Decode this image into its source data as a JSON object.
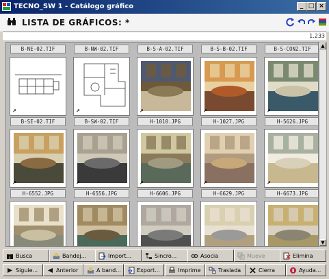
{
  "window": {
    "title": "TECNO_SW 1 - Catálogo gráfico",
    "minimize": "_",
    "maximize": "□",
    "close": "×"
  },
  "header": {
    "title": "LISTA DE GRÁFICOS: *"
  },
  "filter": {
    "count": "1.233"
  },
  "top_row": [
    "B-NE-02.TIF",
    "B-NW-02.TIF",
    "B-S-A-02.TIF",
    "B-S-B-02.TIF",
    "B-S-CON2.TIF"
  ],
  "items": [
    {
      "name": "B-SE-02.TIF",
      "kind": "plan1"
    },
    {
      "name": "B-SW-02.TIF",
      "kind": "plan2"
    },
    {
      "name": "H-1010.JPG",
      "kind": "photo",
      "palette": [
        "#8a7a55",
        "#4f5a70",
        "#c8b89a",
        "#6e5a3a"
      ]
    },
    {
      "name": "H-1027.JPG",
      "kind": "photo",
      "palette": [
        "#b05a2a",
        "#d89a50",
        "#7a4a30",
        "#e8d0a0"
      ]
    },
    {
      "name": "H-5626.JPG",
      "kind": "photo",
      "palette": [
        "#c9c2a8",
        "#7a8a70",
        "#3a5a6a",
        "#e0dcc8"
      ]
    },
    {
      "name": "H-6552.JPG",
      "kind": "photo",
      "palette": [
        "#8a6a40",
        "#c8a060",
        "#4a4a3a",
        "#d8cfb0"
      ]
    },
    {
      "name": "H-6556.JPG",
      "kind": "photo",
      "palette": [
        "#6a6a6a",
        "#a8a090",
        "#3a3a3a",
        "#d0c8b8"
      ]
    },
    {
      "name": "H-6606.JPG",
      "kind": "photo",
      "palette": [
        "#a09a80",
        "#d0c8a0",
        "#5a6a5a",
        "#8a7a5a"
      ]
    },
    {
      "name": "H-6629.JPG",
      "kind": "photo",
      "palette": [
        "#c8a878",
        "#e0d0b0",
        "#8a7060",
        "#b09a80"
      ]
    },
    {
      "name": "H-6673.JPG",
      "kind": "photo",
      "palette": [
        "#d8d0b8",
        "#a8b0a0",
        "#c8b890",
        "#f0ece0"
      ]
    },
    {
      "name": "",
      "kind": "photo",
      "palette": [
        "#c8c0a0",
        "#e8e0c8",
        "#8a8a7a",
        "#a09070"
      ]
    },
    {
      "name": "",
      "kind": "photo",
      "palette": [
        "#6a5a40",
        "#a08a60",
        "#4a6a5a",
        "#d0c0a0"
      ]
    },
    {
      "name": "",
      "kind": "photo",
      "palette": [
        "#7a7a78",
        "#b0a8a0",
        "#505050",
        "#d0ccc0"
      ]
    },
    {
      "name": "",
      "kind": "photo",
      "palette": [
        "#9a9a98",
        "#d8d0b0",
        "#b0a080",
        "#e8e0d0"
      ]
    },
    {
      "name": "",
      "kind": "photo",
      "palette": [
        "#8a8470",
        "#c8b070",
        "#a89868",
        "#d8d0c0"
      ]
    }
  ],
  "buttons_row1": [
    {
      "label": "Busca",
      "icon": "binoculars-icon",
      "disabled": false
    },
    {
      "label": "Bandej...",
      "icon": "tray-icon",
      "disabled": false
    },
    {
      "label": "Import...",
      "icon": "import-icon",
      "disabled": false
    },
    {
      "label": "Sincro...",
      "icon": "sync-icon",
      "disabled": false
    },
    {
      "label": "Asocia",
      "icon": "link-icon",
      "disabled": false
    },
    {
      "label": "Mueve",
      "icon": "move-icon",
      "disabled": true
    },
    {
      "label": "Elimina",
      "icon": "delete-icon",
      "disabled": false
    }
  ],
  "buttons_row2": [
    {
      "label": "Siguie...",
      "icon": "next-icon",
      "disabled": false
    },
    {
      "label": "Anterior",
      "icon": "previous-icon",
      "disabled": false
    },
    {
      "label": "A band...",
      "icon": "to-tray-icon",
      "disabled": false
    },
    {
      "label": "Export...",
      "icon": "export-icon",
      "disabled": false
    },
    {
      "label": "Imprime",
      "icon": "printer-icon",
      "disabled": false
    },
    {
      "label": "Traslada",
      "icon": "transfer-icon",
      "disabled": false
    },
    {
      "label": "Cierra",
      "icon": "close-x-icon",
      "disabled": false
    },
    {
      "label": "Ayuda...",
      "icon": "help-icon",
      "disabled": false
    }
  ],
  "colors": {
    "titlebar": "#0a246a",
    "header_bg": "#f4f4f4",
    "grid_bg": "#bcbcbc",
    "face": "#d4d0c8"
  }
}
